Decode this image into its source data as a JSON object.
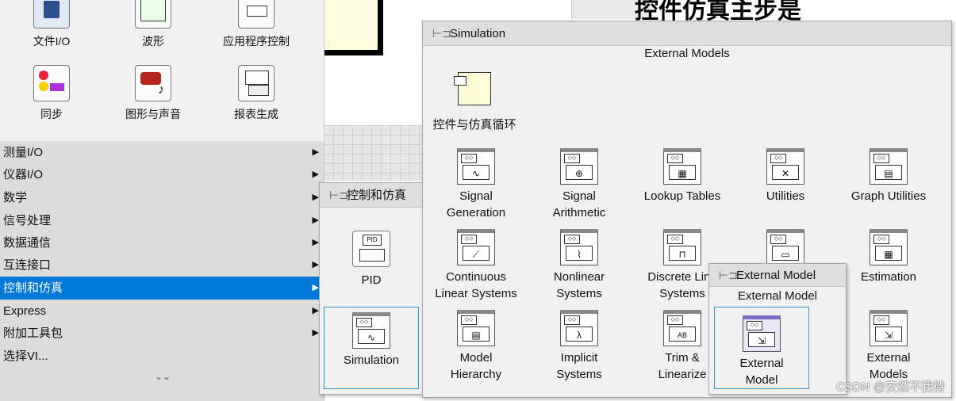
{
  "background": {
    "heading": "控件仿真主步是"
  },
  "main_palette": {
    "top_items": [
      {
        "label": "文件I/O",
        "icon": "file-io-icon"
      },
      {
        "label": "波形",
        "icon": "waveform-icon"
      },
      {
        "label": "应用程序控制",
        "icon": "app-control-icon"
      },
      {
        "label": "同步",
        "icon": "sync-icon"
      },
      {
        "label": "图形与声音",
        "icon": "graphics-sound-icon"
      },
      {
        "label": "报表生成",
        "icon": "report-icon"
      }
    ],
    "menu": [
      {
        "label": "测量I/O",
        "arrow": "▶"
      },
      {
        "label": "仪器I/O",
        "arrow": "▶"
      },
      {
        "label": "数学",
        "arrow": "▶"
      },
      {
        "label": "信号处理",
        "arrow": "▶"
      },
      {
        "label": "数据通信",
        "arrow": "▶"
      },
      {
        "label": "互连接口",
        "arrow": "▶"
      },
      {
        "label": "控制和仿真",
        "arrow": "▶",
        "selected": true
      },
      {
        "label": "Express",
        "arrow": "▶"
      },
      {
        "label": "附加工具包",
        "arrow": "▶"
      },
      {
        "label": "选择VI...",
        "arrow": ""
      }
    ],
    "expand_glyph": "⌄⌄"
  },
  "control_palette": {
    "title": "控制和仿真",
    "items": [
      {
        "label": "PID",
        "icon": "pid-icon"
      },
      {
        "label": "Simulation",
        "icon": "simulation-icon"
      }
    ]
  },
  "simulation_palette": {
    "title": "Simulation",
    "section": "External Models",
    "loop_item": {
      "label": "控件与仿真循环",
      "icon": "control-sim-loop-icon"
    },
    "grid": [
      {
        "label": "Signal\nGeneration",
        "icon": "signal-generation-icon",
        "glyph": "∿"
      },
      {
        "label": "Signal\nArithmetic",
        "icon": "signal-arithmetic-icon",
        "glyph": "⊕"
      },
      {
        "label": "Lookup Tables",
        "icon": "lookup-tables-icon",
        "glyph": "▦"
      },
      {
        "label": "Utilities",
        "icon": "utilities-icon",
        "glyph": "✕"
      },
      {
        "label": "Graph Utilities",
        "icon": "graph-utilities-icon",
        "glyph": "▤"
      },
      {
        "label": "Continuous\nLinear Systems",
        "icon": "continuous-linear-icon",
        "glyph": "⟋"
      },
      {
        "label": "Nonlinear\nSystems",
        "icon": "nonlinear-icon",
        "glyph": "⌇"
      },
      {
        "label": "Discrete Line\nSystems",
        "icon": "discrete-linear-icon",
        "glyph": "⊓"
      },
      {
        "label": "",
        "icon": "optimization-icon",
        "glyph": "▭"
      },
      {
        "label": "Estimation",
        "icon": "estimation-icon",
        "glyph": "▦"
      },
      {
        "label": "Model\nHierarchy",
        "icon": "model-hierarchy-icon",
        "glyph": "▤"
      },
      {
        "label": "Implicit\nSystems",
        "icon": "implicit-systems-icon",
        "glyph": "λ"
      },
      {
        "label": "Trim &\nLinearize",
        "icon": "trim-linearize-icon",
        "glyph": "AB"
      },
      {
        "label": "",
        "icon": "hidden-icon",
        "glyph": ""
      },
      {
        "label": "External\nModels",
        "icon": "external-models-icon",
        "glyph": "⇲"
      }
    ]
  },
  "external_model_palette": {
    "title": "External Model",
    "section": "External Model",
    "item": {
      "label": "External\nModel",
      "icon": "external-model-icon"
    }
  },
  "watermark": "CSDN @安然不我待"
}
